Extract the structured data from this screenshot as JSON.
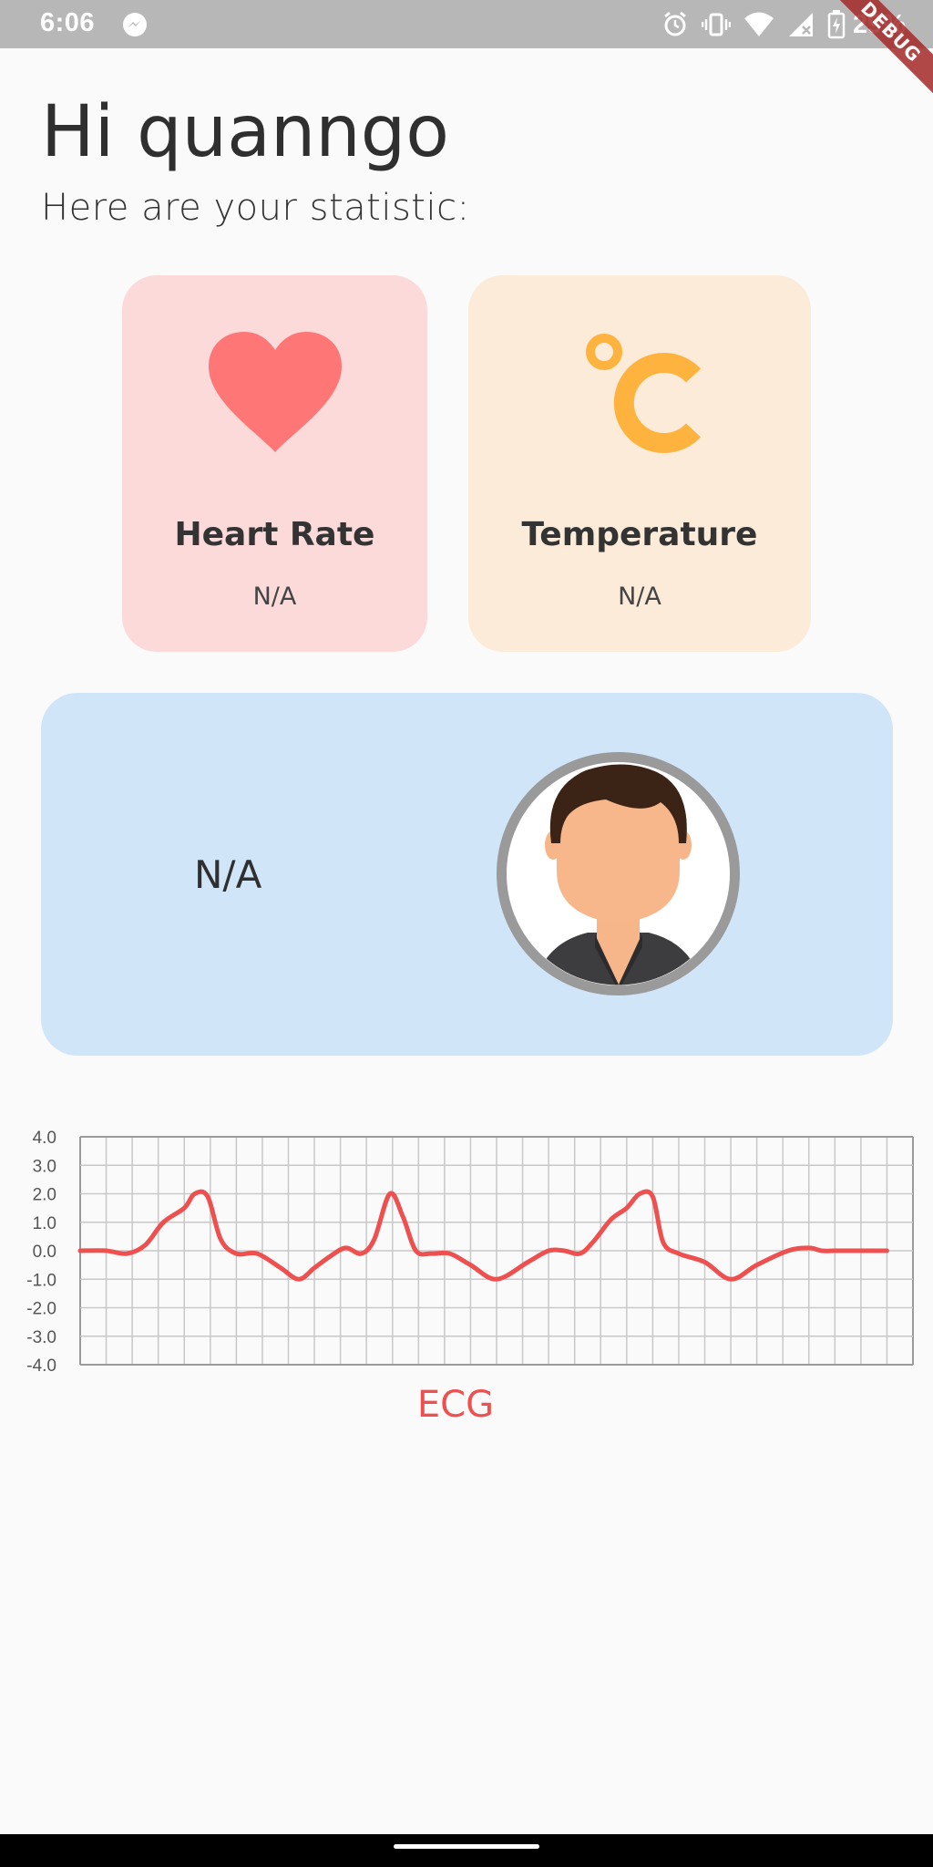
{
  "status_bar": {
    "time": "6:06",
    "battery": "29%",
    "icons": [
      "messenger-icon",
      "alarm-icon",
      "vibrate-icon",
      "wifi-icon",
      "signal-icon",
      "battery-charging-icon"
    ]
  },
  "debug_banner": "DEBUG",
  "header": {
    "greeting": "Hi quanngo",
    "subtitle": "Here are your statistic:"
  },
  "cards": {
    "heart_rate": {
      "title": "Heart Rate",
      "value": "N/A",
      "icon": "heart-icon",
      "background": "#fcdada",
      "icon_color": "#ff7676"
    },
    "temperature": {
      "title": "Temperature",
      "value": "N/A",
      "icon": "celsius-icon",
      "background": "#fbebd8",
      "icon_color": "#ffb33f"
    }
  },
  "profile": {
    "value": "N/A",
    "background": "#d0e5f8",
    "avatar": "avatar-icon"
  },
  "chart_data": {
    "type": "line",
    "title": "",
    "xlabel": "ECG",
    "ylabel": "",
    "ylim": [
      -4,
      4
    ],
    "yticks": [
      "4.0",
      "3.0",
      "2.0",
      "1.0",
      "0.0",
      "-1.0",
      "-2.0",
      "-3.0",
      "-4.0"
    ],
    "grid": true,
    "line_color": "#ee5050",
    "series": [
      {
        "x": [
          0,
          1,
          1.8,
          2.5,
          3.2,
          4,
          4.4,
          4.9,
          5.4,
          6,
          6.8,
          7.7,
          8.4,
          9,
          9.6,
          10.2,
          10.8,
          11.3,
          11.9,
          12.4,
          12.9,
          13.5,
          14.2,
          15,
          16,
          17.2,
          18,
          18.6,
          19.2,
          19.7,
          20.4,
          21,
          21.5,
          22,
          22.4,
          23,
          24,
          25,
          26,
          27.2,
          28,
          28.5,
          29,
          29.6,
          30,
          31
        ],
        "y": [
          0,
          0,
          -0.1,
          0.2,
          1.0,
          1.5,
          2.0,
          1.9,
          0.4,
          -0.1,
          -0.1,
          -0.6,
          -1.0,
          -0.6,
          -0.2,
          0.1,
          -0.1,
          0.4,
          2.0,
          1.2,
          0.0,
          -0.1,
          -0.1,
          -0.5,
          -1.0,
          -0.4,
          0.0,
          0,
          -0.1,
          0.3,
          1.1,
          1.5,
          2.0,
          1.9,
          0.3,
          -0.1,
          -0.4,
          -1.0,
          -0.5,
          0.0,
          0.1,
          0,
          0,
          0,
          0,
          0
        ]
      }
    ]
  },
  "nav": {}
}
